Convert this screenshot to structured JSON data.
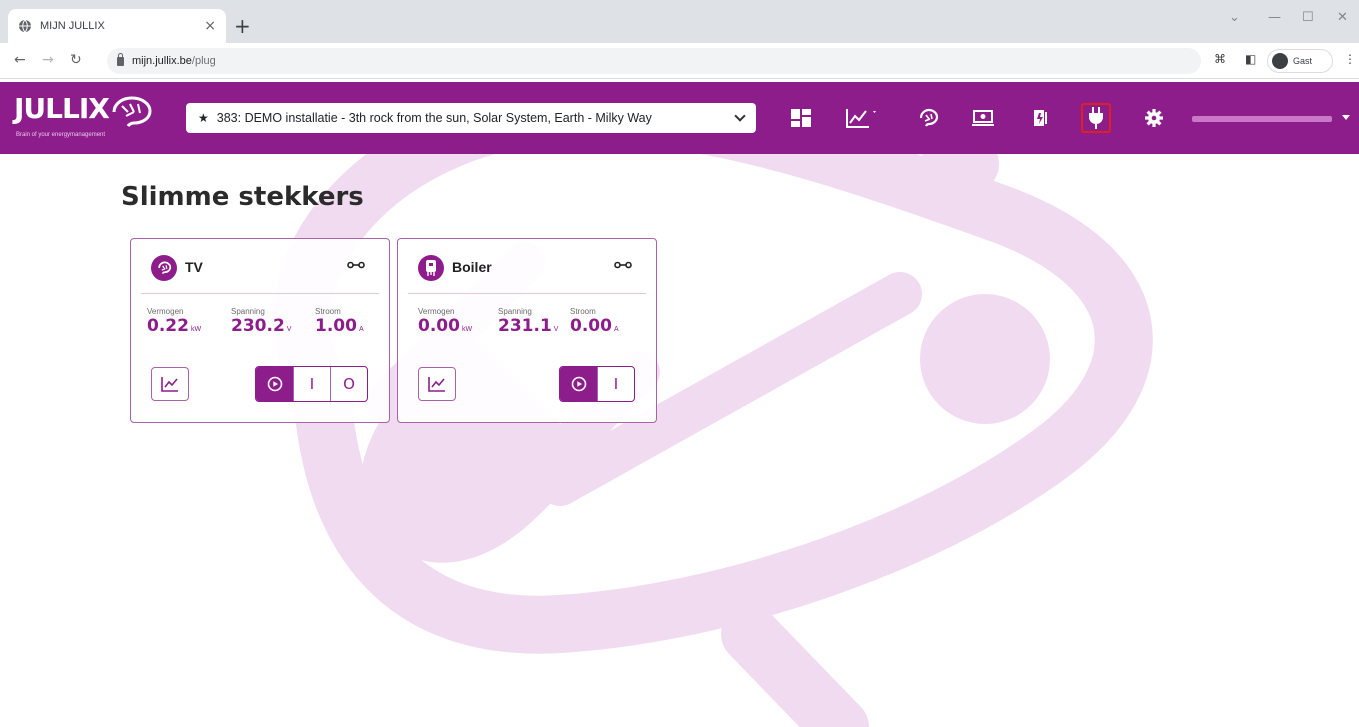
{
  "browser": {
    "tab_title": "MIJN JULLIX",
    "tab_close": "×",
    "new_tab": "+",
    "url_domain": "mijn.jullix.be",
    "url_path": "/plug",
    "profile_label": "Gast"
  },
  "header": {
    "logo_text": "JULLIX",
    "logo_tagline": "Brain of your energymanagement",
    "installation_star": "★",
    "installation_label": "383: DEMO installatie - 3th rock from the sun, Solar System, Earth - Milky Way",
    "nav_icons": [
      "dashboard-icon",
      "chart-icon",
      "brain-icon",
      "money-icon",
      "battery-charge-icon",
      "plug-icon",
      "gear-icon"
    ],
    "active_nav": "plug-icon"
  },
  "page": {
    "title": "Slimme stekkers"
  },
  "plugs": [
    {
      "name": "TV",
      "icon": "brain-icon",
      "metrics": [
        {
          "label": "Vermogen",
          "value": "0.22",
          "unit": "kW"
        },
        {
          "label": "Spanning",
          "value": "230.2",
          "unit": "V"
        },
        {
          "label": "Stroom",
          "value": "1.00",
          "unit": "A"
        }
      ],
      "modes": [
        "auto",
        "on",
        "off"
      ],
      "selected_mode": "auto",
      "on_glyph": "I",
      "off_glyph": "O"
    },
    {
      "name": "Boiler",
      "icon": "boiler-icon",
      "metrics": [
        {
          "label": "Vermogen",
          "value": "0.00",
          "unit": "kW"
        },
        {
          "label": "Spanning",
          "value": "231.1",
          "unit": "V"
        },
        {
          "label": "Stroom",
          "value": "0.00",
          "unit": "A"
        }
      ],
      "modes": [
        "auto",
        "on"
      ],
      "selected_mode": "auto",
      "on_glyph": "I"
    }
  ],
  "colors": {
    "brand": "#8e1d8c",
    "watermark": "#f1dbf0",
    "active_outline": "#e02020"
  }
}
